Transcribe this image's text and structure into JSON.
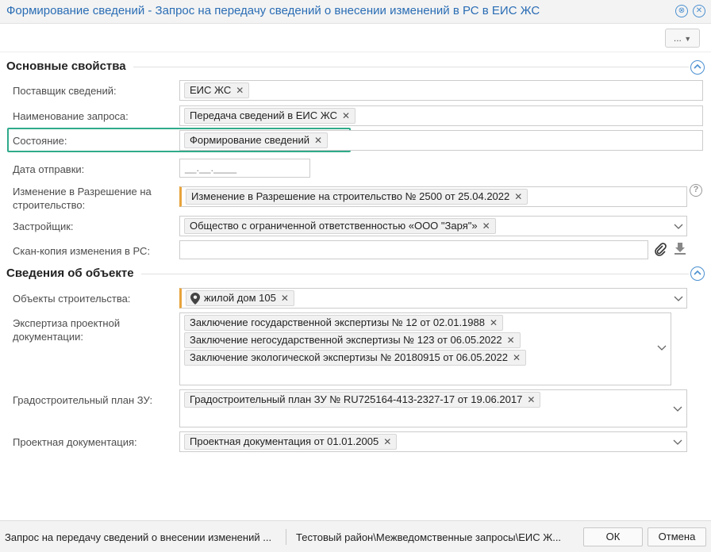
{
  "window": {
    "title": "Формирование сведений - Запрос на передачу сведений о внесении изменений в РС в ЕИС ЖС",
    "toolbar_more_label": "..."
  },
  "sections": {
    "main": "Основные свойства",
    "object": "Сведения об объекте"
  },
  "fields": {
    "supplier": {
      "label": "Поставщик сведений:",
      "tag": "ЕИС ЖС"
    },
    "request_name": {
      "label": "Наименование запроса:",
      "tag": "Передача сведений в ЕИС ЖС"
    },
    "state": {
      "label": "Состояние:",
      "tag": "Формирование сведений"
    },
    "send_date": {
      "label": "Дата отправки:",
      "value": "__.__.____"
    },
    "permit_change": {
      "label": "Изменение в Разрешение на строительство:",
      "tag": "Изменение в Разрешение на строительство № 2500 от 25.04.2022"
    },
    "developer": {
      "label": "Застройщик:",
      "tag": "Общество с ограниченной ответственностью «ООО \"Заря\"»"
    },
    "scan": {
      "label": "Скан-копия изменения в РС:",
      "value": ""
    },
    "construction_objects": {
      "label": "Объекты строительства:",
      "tag": "жилой дом 105"
    },
    "expertise": {
      "label": "Экспертиза проектной документации:",
      "tags": [
        "Заключение государственной экспертизы № 12 от 02.01.1988",
        "Заключение негосударственной экспертизы № 123 от 06.05.2022",
        "Заключение экологической экспертизы № 20180915 от 06.05.2022"
      ]
    },
    "urban_plan": {
      "label": "Градостроительный план ЗУ:",
      "tag": "Градостроительный план ЗУ № RU725164-413-2327-17 от 19.06.2017"
    },
    "project_docs": {
      "label": "Проектная документация:",
      "tag": "Проектная документация от 01.01.2005"
    }
  },
  "statusbar": {
    "left": "Запрос на передачу сведений о внесении изменений ...",
    "path": "Тестовый район\\Межведомственные запросы\\ЕИС Ж...",
    "ok": "ОК",
    "cancel": "Отмена"
  },
  "icons": {
    "title_icon_1": "settings-circle-icon",
    "title_icon_2": "close-icon",
    "help": "question-icon",
    "attach": "paperclip-icon",
    "download": "download-icon",
    "location": "map-pin-icon",
    "collapse": "chevron-up-icon",
    "dropdown": "chevron-down-icon"
  },
  "colors": {
    "title": "#2a6db5",
    "required_marker": "#e8a33c",
    "focus_outline": "#2faa8a",
    "accent": "#4a8fd0"
  }
}
